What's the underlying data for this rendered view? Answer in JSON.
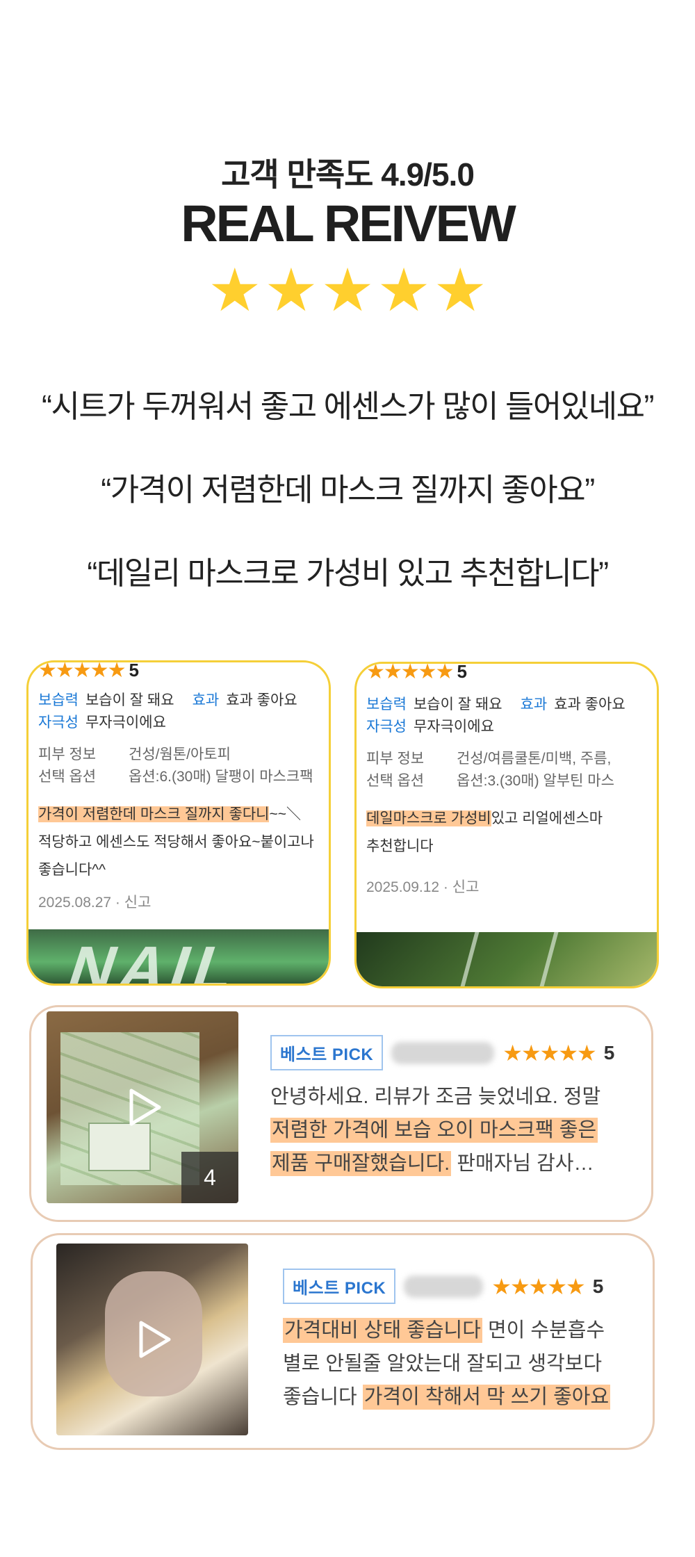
{
  "header": {
    "satisfaction": "고객 만족도 4.9/5.0",
    "title": "REAL REIVEW",
    "stars": "★★★★★"
  },
  "quotes": [
    "“시트가 두꺼워서 좋고 에센스가 많이 들어있네요”",
    "“가격이 저렴한데 마스크 질까지 좋아요”",
    "“데일리 마스크로 가성비 있고 추천합니다”"
  ],
  "cards": [
    {
      "stars": "★★★★★",
      "rating": "5",
      "k1": "보습력",
      "v1": "보습이 잘 돼요",
      "k2": "효과",
      "v2": "효과 좋아요",
      "k3": "자극성",
      "v3": "무자극이에요",
      "skin_label": "피부 정보",
      "skin_value": "건성/웜톤/아토피",
      "option_label": "선택 옵션",
      "option_value": "옵션:6.(30매) 달팽이 마스크팩",
      "highlight": "가격이 저렴한데 마스크 질까지 좋다니",
      "text_rest": "~~＼",
      "text_line2": "적당하고 에센스도 적당해서 좋아요~붙이고나",
      "text_line3": "좋습니다^^",
      "date": "2025.08.27 · 신고"
    },
    {
      "stars": "★★★★★",
      "rating": "5",
      "k1": "보습력",
      "v1": "보습이 잘 돼요",
      "k2": "효과",
      "v2": "효과 좋아요",
      "k3": "자극성",
      "v3": "무자극이에요",
      "skin_label": "피부 정보",
      "skin_value": "건성/여름쿨톤/미백, 주름,",
      "option_label": "선택 옵션",
      "option_value": "옵션:3.(30매) 알부틴 마스",
      "highlight": "데일마스크로 가성비",
      "text_rest": "있고 리얼에센스마",
      "text_line2": "추천합니다",
      "text_line3": "",
      "date": "2025.09.12 · 신고"
    }
  ],
  "best_reviews": [
    {
      "pick_label": "베스트 PICK",
      "stars": "★★★★★",
      "rating": "5",
      "media_count": "4",
      "line1": "안녕하세요. 리뷰가 조금 늦었네요. 정말",
      "highlight_line2": "저렴한 가격에 보습 오이 마스크팩 좋은",
      "highlight_line3": "제품 구매잘했습니다.",
      "line3_rest": " 판매자님 감사…"
    },
    {
      "pick_label": "베스트 PICK",
      "stars": "★★★★★",
      "rating": "5",
      "highlight_line1": "가격대비 상태 좋습니다",
      "line1_rest": " 면이 수분흡수",
      "line2": "별로 안될줄 알았는대 잘되고 생각보다",
      "line3_start": "좋습니다 ",
      "highlight_line3": "가격이 착해서 막 쓰기 좋아요"
    }
  ],
  "colors": {
    "star_gold": "#ffcf2e",
    "card_border": "#f5cf38",
    "highlight": "#ffc896",
    "label_blue": "#1a78d6",
    "small_star": "#f79a12"
  }
}
